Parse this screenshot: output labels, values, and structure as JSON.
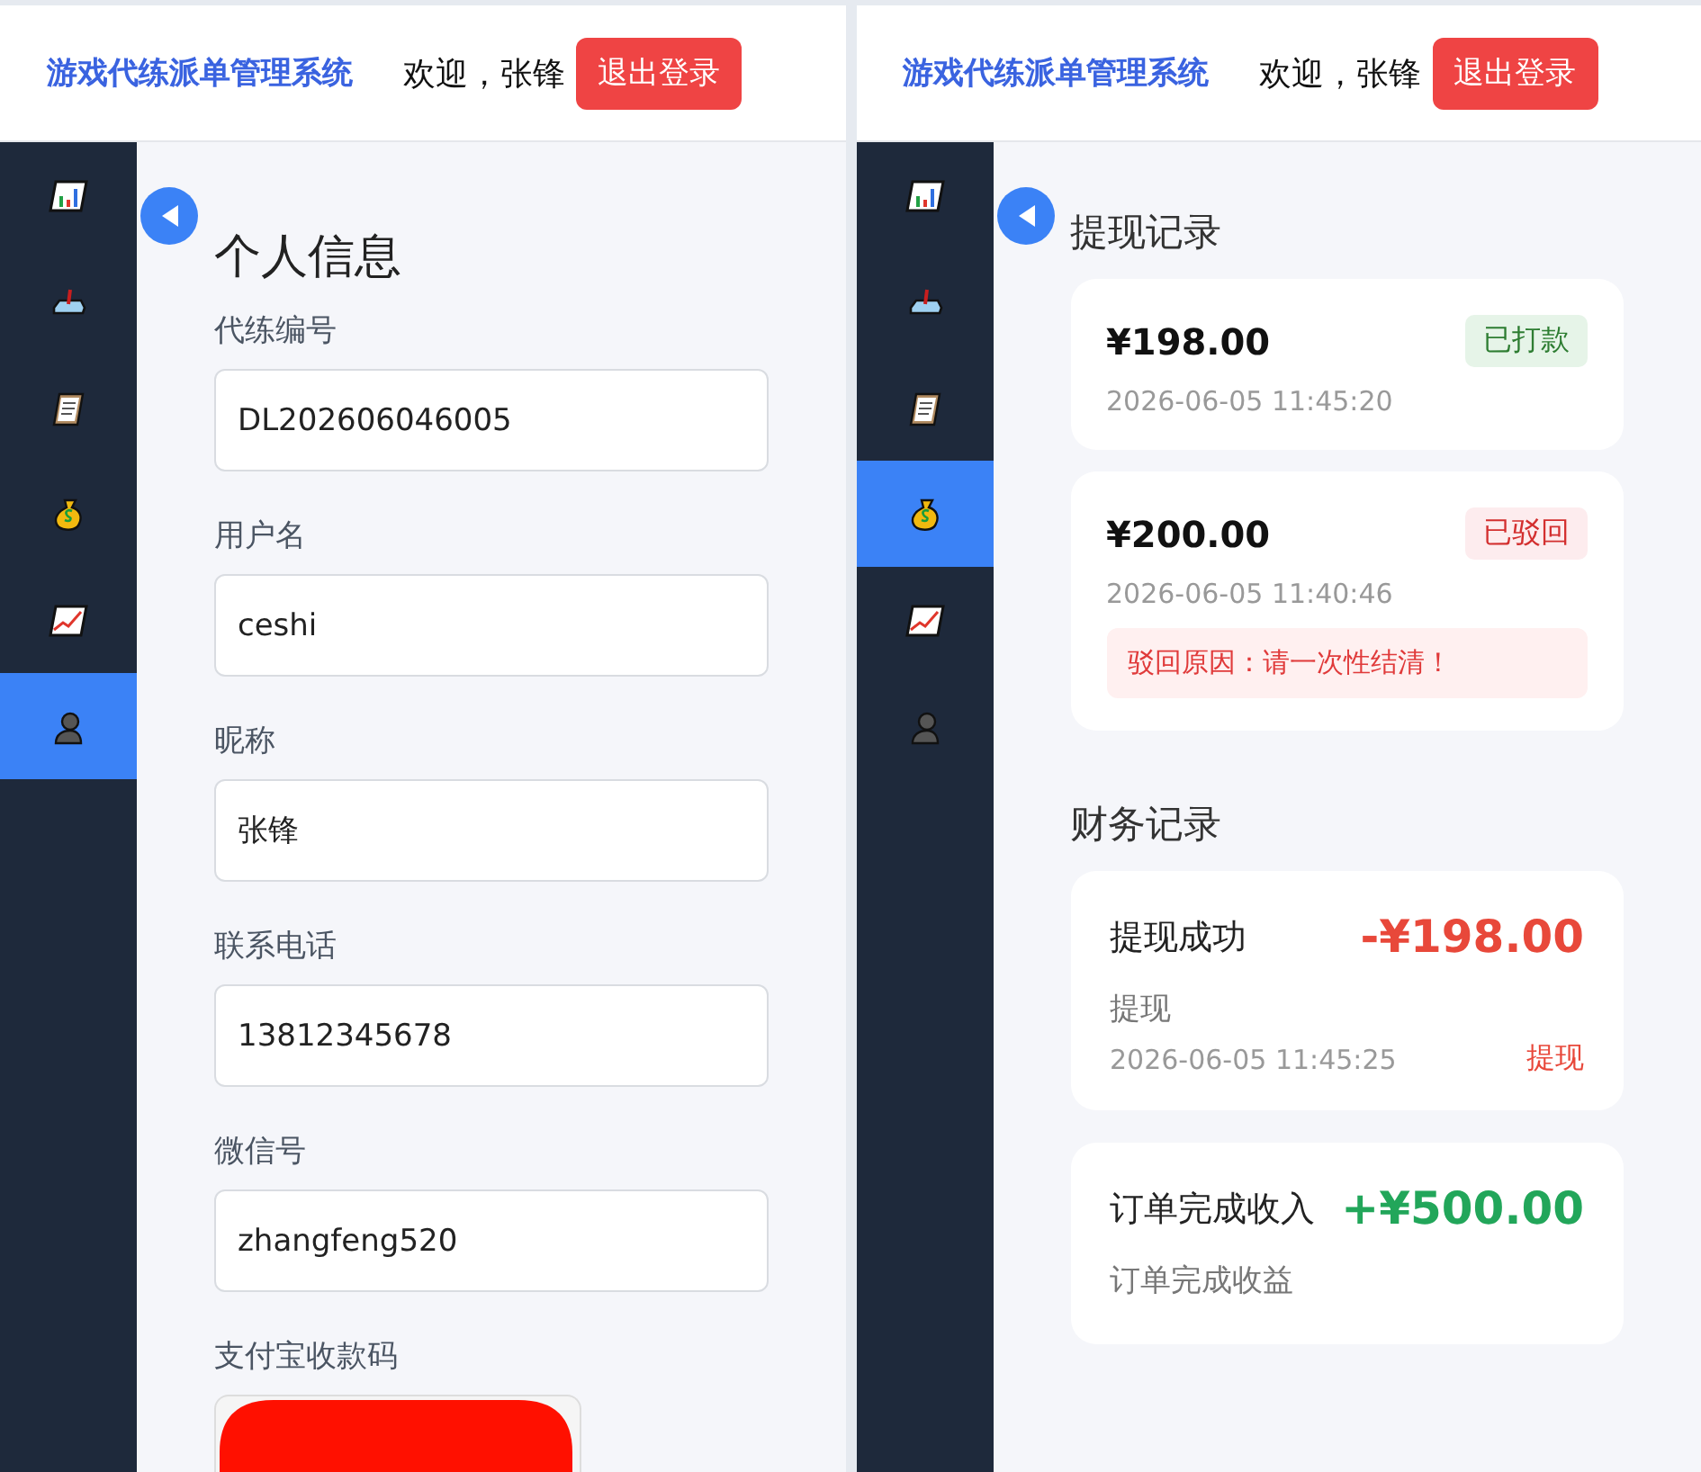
{
  "panels": [
    {
      "header": {
        "title": "游戏代练派单管理系统",
        "welcome": "欢迎，张锋",
        "logout": "退出登录"
      },
      "sidebar": {
        "items": [
          {
            "kind": "bar-chart",
            "selected": false
          },
          {
            "kind": "joystick",
            "selected": false
          },
          {
            "kind": "clipboard",
            "selected": false
          },
          {
            "kind": "money-bag",
            "selected": false
          },
          {
            "kind": "line-chart",
            "selected": false
          },
          {
            "kind": "user",
            "selected": true
          }
        ]
      },
      "content": {
        "kind": "profile",
        "title": "个人信息",
        "fields": [
          {
            "label": "代练编号",
            "value": "DL202606046005"
          },
          {
            "label": "用户名",
            "value": "ceshi"
          },
          {
            "label": "昵称",
            "value": "张锋"
          },
          {
            "label": "联系电话",
            "value": "13812345678"
          },
          {
            "label": "微信号",
            "value": "zhangfeng520"
          }
        ],
        "qr_label": "支付宝收款码"
      }
    },
    {
      "header": {
        "title": "游戏代练派单管理系统",
        "welcome": "欢迎，张锋",
        "logout": "退出登录"
      },
      "sidebar": {
        "items": [
          {
            "kind": "bar-chart",
            "selected": false
          },
          {
            "kind": "joystick",
            "selected": false
          },
          {
            "kind": "clipboard",
            "selected": false
          },
          {
            "kind": "money-bag",
            "selected": true
          },
          {
            "kind": "line-chart",
            "selected": false
          },
          {
            "kind": "user",
            "selected": false
          }
        ]
      },
      "content": {
        "kind": "finance",
        "withdrawals_title": "提现记录",
        "withdrawals": [
          {
            "amount": "¥198.00",
            "status": "已打款",
            "kind": "paid",
            "time": "2026-06-05 11:45:20"
          },
          {
            "amount": "¥200.00",
            "status": "已驳回",
            "kind": "rejected",
            "time": "2026-06-05 11:40:46",
            "reason": "驳回原因：请一次性结清！"
          }
        ],
        "records_title": "财务记录",
        "records": [
          {
            "title": "提现成功",
            "amount": "-¥198.00",
            "kind": "expense",
            "desc": "提现",
            "time": "2026-06-05 11:45:25",
            "type": "提现"
          },
          {
            "title": "订单完成收入",
            "amount": "+¥500.00",
            "kind": "income",
            "desc": "订单完成收益"
          }
        ]
      }
    }
  ]
}
